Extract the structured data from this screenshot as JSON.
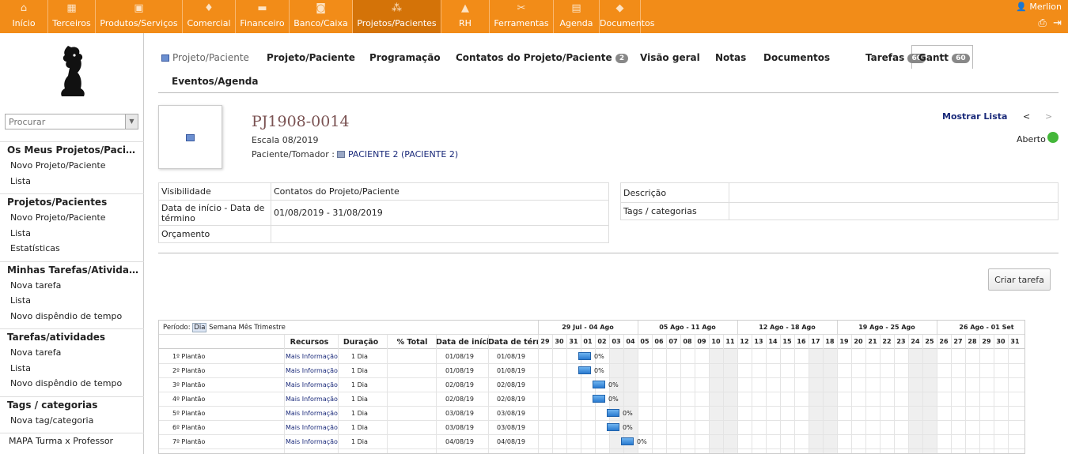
{
  "topnav": {
    "items": [
      {
        "label": "Início",
        "icon": "home-icon",
        "glyph": "⌂"
      },
      {
        "label": "Terceiros",
        "icon": "building-icon",
        "glyph": "▦"
      },
      {
        "label": "Produtos/Serviços",
        "icon": "cubes-icon",
        "glyph": "▣"
      },
      {
        "label": "Comercial",
        "icon": "bulb-icon",
        "glyph": "♦"
      },
      {
        "label": "Financeiro",
        "icon": "money-icon",
        "glyph": "▬"
      },
      {
        "label": "Banco/Caixa",
        "icon": "safe-icon",
        "glyph": "◙"
      },
      {
        "label": "Projetos/Pacientes",
        "icon": "sitemap-icon",
        "glyph": "⁂"
      },
      {
        "label": "RH",
        "icon": "hat-icon",
        "glyph": "▲"
      },
      {
        "label": "Ferramentas",
        "icon": "tools-icon",
        "glyph": "✂"
      },
      {
        "label": "Agenda",
        "icon": "calendar-icon",
        "glyph": "▤"
      },
      {
        "label": "Documentos",
        "icon": "folder-icon",
        "glyph": "◆"
      }
    ],
    "active_index": 6,
    "user": "Merlion",
    "print_icon": "⎙",
    "logout_icon": "⇥"
  },
  "sidebar": {
    "search_placeholder": "Procurar",
    "sections": [
      {
        "title": "Os Meus Projetos/Pacie...",
        "items": [
          "Novo Projeto/Paciente",
          "Lista"
        ]
      },
      {
        "title": "Projetos/Pacientes",
        "items": [
          "Novo Projeto/Paciente",
          "Lista",
          "Estatísticas"
        ]
      },
      {
        "title": "Minhas Tarefas/Atividad...",
        "items": [
          "Nova tarefa",
          "Lista",
          "Novo dispêndio de tempo"
        ]
      },
      {
        "title": "Tarefas/atividades",
        "items": [
          "Nova tarefa",
          "Lista",
          "Novo dispêndio de tempo"
        ]
      },
      {
        "title": "Tags / categorias",
        "items": [
          "Nova tag/categoria"
        ]
      },
      {
        "title": "",
        "items": [
          "MAPA Turma x Professor"
        ]
      }
    ]
  },
  "tabs": {
    "first": "Projeto/Paciente",
    "items": [
      {
        "label": "Projeto/Paciente",
        "badge": ""
      },
      {
        "label": "Programação",
        "badge": ""
      },
      {
        "label": "Contatos do Projeto/Paciente",
        "badge": "2"
      },
      {
        "label": "Visão geral",
        "badge": ""
      },
      {
        "label": "Notas",
        "badge": ""
      },
      {
        "label": "Documentos",
        "badge": ""
      },
      {
        "label": "Tarefas",
        "badge": "60"
      },
      {
        "label": "Gantt",
        "badge": "60"
      },
      {
        "label": "Eventos/Agenda",
        "badge": ""
      }
    ],
    "active": "Gantt"
  },
  "project": {
    "ref": "PJ1908-0014",
    "label": "Escala 08/2019",
    "client_label": "Paciente/Tomador :",
    "client": "PACIENTE 2 (PACIENTE 2)",
    "show_list": "Mostrar Lista",
    "prev": "<",
    "next": ">",
    "status": "Aberto",
    "status_color": "#44b73a"
  },
  "fields_left": [
    {
      "label": "Visibilidade",
      "value": "Contatos do Projeto/Paciente"
    },
    {
      "label": "Data de início - Data de término",
      "value": "01/08/2019 - 31/08/2019"
    },
    {
      "label": "Orçamento",
      "value": ""
    }
  ],
  "fields_right": [
    {
      "label": "Descrição",
      "value": ""
    },
    {
      "label": "Tags / categorias",
      "value": ""
    }
  ],
  "create_task_button": "Criar tarefa",
  "gantt": {
    "period_label": "Período:",
    "period_options": [
      "Dia",
      "Semana",
      "Mês",
      "Trimestre"
    ],
    "period_selected": "Dia",
    "columns": [
      "Recursos",
      "Duração",
      "% Total",
      "Data de início",
      "Data de término"
    ],
    "weeks": [
      "29 Jul - 04 Ago",
      "05 Ago - 11 Ago",
      "12 Ago - 18 Ago",
      "19 Ago - 25 Ago",
      "26 Ago - 01 Set"
    ],
    "days": [
      "29",
      "30",
      "31",
      "01",
      "02",
      "03",
      "04",
      "05",
      "06",
      "07",
      "08",
      "09",
      "10",
      "11",
      "12",
      "13",
      "14",
      "15",
      "16",
      "17",
      "18",
      "19",
      "20",
      "21",
      "22",
      "23",
      "24",
      "25",
      "26",
      "27",
      "28",
      "29",
      "30",
      "31"
    ],
    "weekend_indices": [
      5,
      6,
      12,
      13,
      19,
      20,
      26,
      27
    ],
    "rows": [
      {
        "name": "1º Plantão",
        "resource": "Mais Informação",
        "duration": "1 Dia",
        "start": "01/08/19",
        "end": "01/08/19",
        "day_index": 3,
        "progress": "0%"
      },
      {
        "name": "2º Plantão",
        "resource": "Mais Informação",
        "duration": "1 Dia",
        "start": "01/08/19",
        "end": "01/08/19",
        "day_index": 3,
        "progress": "0%"
      },
      {
        "name": "3º Plantão",
        "resource": "Mais Informação",
        "duration": "1 Dia",
        "start": "02/08/19",
        "end": "02/08/19",
        "day_index": 4,
        "progress": "0%"
      },
      {
        "name": "4º Plantão",
        "resource": "Mais Informação",
        "duration": "1 Dia",
        "start": "02/08/19",
        "end": "02/08/19",
        "day_index": 4,
        "progress": "0%"
      },
      {
        "name": "5º Plantão",
        "resource": "Mais Informação",
        "duration": "1 Dia",
        "start": "03/08/19",
        "end": "03/08/19",
        "day_index": 5,
        "progress": "0%"
      },
      {
        "name": "6º Plantão",
        "resource": "Mais Informação",
        "duration": "1 Dia",
        "start": "03/08/19",
        "end": "03/08/19",
        "day_index": 5,
        "progress": "0%"
      },
      {
        "name": "7º Plantão",
        "resource": "Mais Informação",
        "duration": "1 Dia",
        "start": "04/08/19",
        "end": "04/08/19",
        "day_index": 6,
        "progress": "0%"
      }
    ]
  }
}
